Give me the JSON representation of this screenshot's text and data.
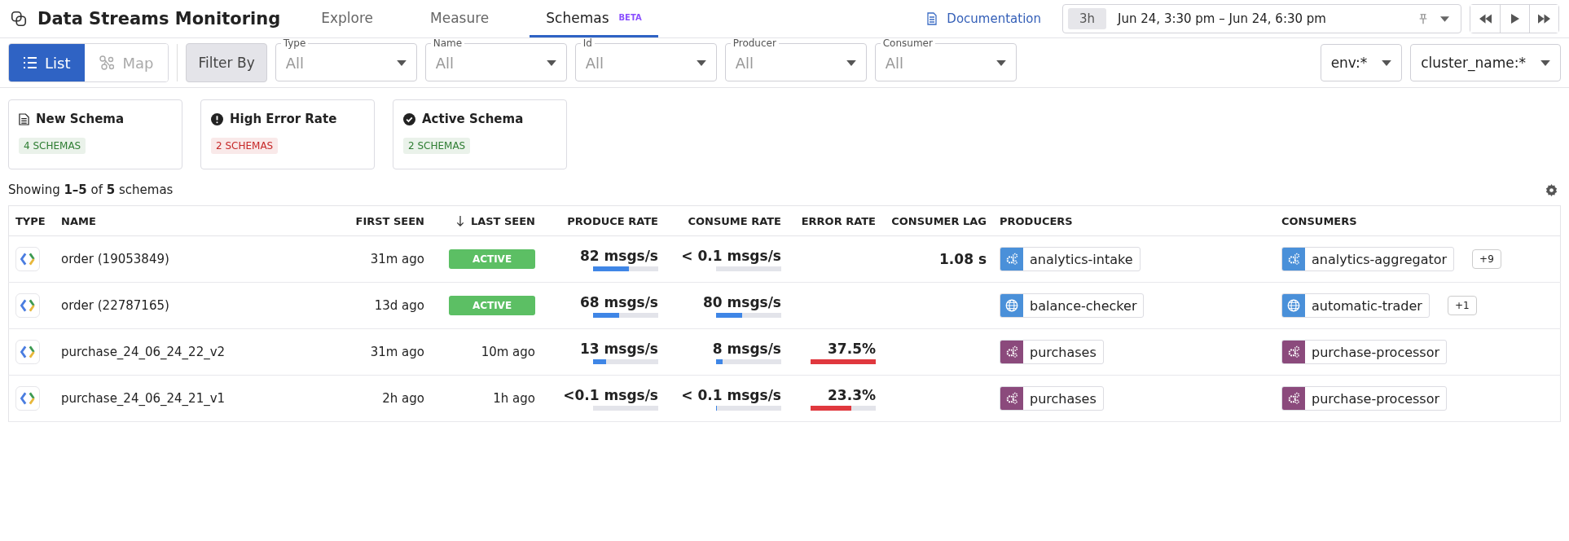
{
  "header": {
    "title": "Data Streams Monitoring",
    "tabs": [
      {
        "label": "Explore",
        "selected": false
      },
      {
        "label": "Measure",
        "selected": false
      },
      {
        "label": "Schemas",
        "selected": true,
        "badge": "BETA"
      }
    ],
    "doc_link": "Documentation",
    "time": {
      "preset": "3h",
      "range": "Jun 24, 3:30 pm – Jun 24, 6:30 pm"
    }
  },
  "toolbar": {
    "views": [
      {
        "label": "List",
        "selected": true
      },
      {
        "label": "Map",
        "selected": false
      }
    ],
    "filter_label": "Filter By",
    "filters": [
      {
        "label": "Type",
        "value": "All"
      },
      {
        "label": "Name",
        "value": "All"
      },
      {
        "label": "Id",
        "value": "All"
      },
      {
        "label": "Producer",
        "value": "All"
      },
      {
        "label": "Consumer",
        "value": "All"
      }
    ],
    "tags": [
      "env:*",
      "cluster_name:*"
    ]
  },
  "cards": [
    {
      "kind": "new",
      "title": "New Schema",
      "count": "4 SCHEMAS",
      "color": "#2e7d32"
    },
    {
      "kind": "error",
      "title": "High Error Rate",
      "count": "2 SCHEMAS",
      "color": "#c62828"
    },
    {
      "kind": "active",
      "title": "Active Schema",
      "count": "2 SCHEMAS",
      "color": "#2e7d32"
    }
  ],
  "summary": "Showing **1–5** of **5** schemas",
  "table": {
    "columns": [
      "TYPE",
      "NAME",
      "FIRST SEEN",
      "LAST SEEN",
      "PRODUCE RATE",
      "CONSUME RATE",
      "ERROR RATE",
      "CONSUMER LAG",
      "PRODUCERS",
      "CONSUMERS"
    ],
    "rows": [
      {
        "name": "order (19053849)",
        "first_seen": "31m ago",
        "last_seen": {
          "kind": "badge",
          "text": "ACTIVE"
        },
        "produce": {
          "text": "82 msgs/s",
          "level": 0.55
        },
        "consume": {
          "text": "< 0.1 msgs/s",
          "level": 0
        },
        "error": null,
        "lag": "1.08 s",
        "producer": {
          "kind": "gears",
          "name": "analytics-intake",
          "color": "#4a90d9"
        },
        "consumer": {
          "kind": "gears",
          "name": "analytics-aggregator",
          "color": "#4a90d9",
          "more": "+9"
        }
      },
      {
        "name": "order (22787165)",
        "first_seen": "13d ago",
        "last_seen": {
          "kind": "badge",
          "text": "ACTIVE"
        },
        "produce": {
          "text": "68 msgs/s",
          "level": 0.4
        },
        "consume": {
          "text": "80 msgs/s",
          "level": 0.4
        },
        "error": null,
        "lag": "",
        "producer": {
          "kind": "globe",
          "name": "balance-checker",
          "color": "#4a90d9"
        },
        "consumer": {
          "kind": "globe",
          "name": "automatic-trader",
          "color": "#4a90d9",
          "more": "+1"
        }
      },
      {
        "name": "purchase_24_06_24_22_v2",
        "first_seen": "31m ago",
        "last_seen": {
          "kind": "text",
          "text": "10m ago"
        },
        "produce": {
          "text": "13 msgs/s",
          "level": 0.2
        },
        "consume": {
          "text": "8 msgs/s",
          "level": 0.1
        },
        "error": {
          "text": "37.5%",
          "level": 1
        },
        "lag": "",
        "producer": {
          "kind": "gears",
          "name": "purchases",
          "color": "#8b4a7c"
        },
        "consumer": {
          "kind": "gears",
          "name": "purchase-processor",
          "color": "#8b4a7c"
        }
      },
      {
        "name": "purchase_24_06_24_21_v1",
        "first_seen": "2h ago",
        "last_seen": {
          "kind": "text",
          "text": "1h ago"
        },
        "produce": {
          "text": "<0.1 msgs/s",
          "level": 0
        },
        "consume": {
          "text": "< 0.1 msgs/s",
          "level": 0.01
        },
        "error": {
          "text": "23.3%",
          "level": 0.62
        },
        "lag": "",
        "producer": {
          "kind": "gears",
          "name": "purchases",
          "color": "#8b4a7c"
        },
        "consumer": {
          "kind": "gears",
          "name": "purchase-processor",
          "color": "#8b4a7c"
        }
      }
    ]
  }
}
